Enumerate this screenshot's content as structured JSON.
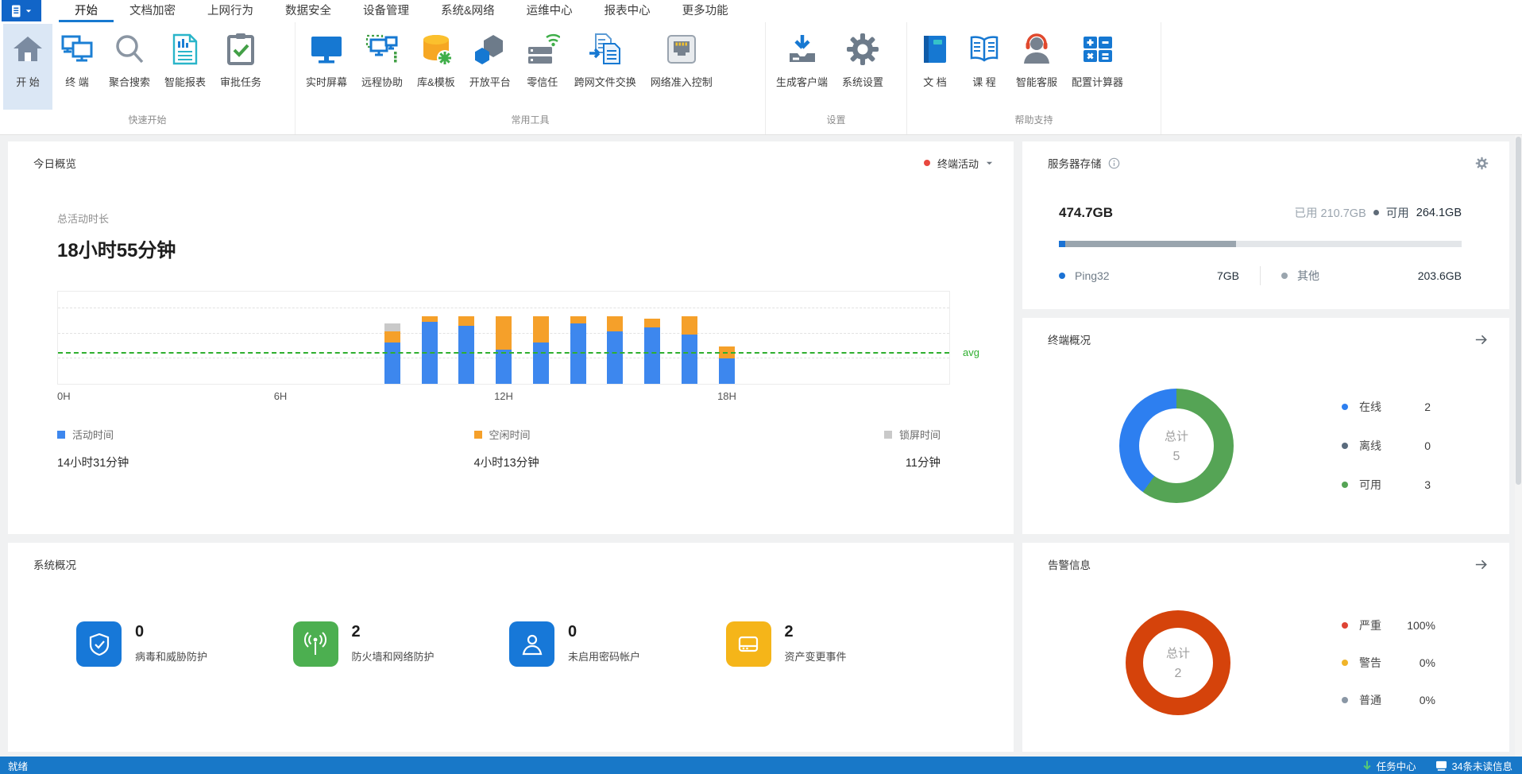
{
  "menu": {
    "tabs": [
      "开始",
      "文档加密",
      "上网行为",
      "数据安全",
      "设备管理",
      "系统&网络",
      "运维中心",
      "报表中心",
      "更多功能"
    ],
    "active": "开始"
  },
  "ribbon": {
    "groups": [
      {
        "label": "快速开始",
        "items": [
          {
            "label": "开 始",
            "icon": "home-icon",
            "selected": true
          },
          {
            "label": "终 端",
            "icon": "terminal-icon"
          },
          {
            "label": "聚合搜索",
            "icon": "search-icon"
          },
          {
            "label": "智能报表",
            "icon": "report-icon"
          },
          {
            "label": "审批任务",
            "icon": "approval-task-icon"
          }
        ]
      },
      {
        "label": "常用工具",
        "items": [
          {
            "label": "实时屏幕",
            "icon": "realtime-screen-icon"
          },
          {
            "label": "远程协助",
            "icon": "remote-assist-icon"
          },
          {
            "label": "库&模板",
            "icon": "library-template-icon"
          },
          {
            "label": "开放平台",
            "icon": "open-platform-icon"
          },
          {
            "label": "零信任",
            "icon": "zero-trust-icon"
          },
          {
            "label": "跨网文件交换",
            "icon": "file-exchange-icon"
          },
          {
            "label": "网络准入控制",
            "icon": "network-access-icon"
          }
        ]
      },
      {
        "label": "设置",
        "items": [
          {
            "label": "生成客户端",
            "icon": "generate-client-icon"
          },
          {
            "label": "系统设置",
            "icon": "gear-icon"
          }
        ]
      },
      {
        "label": "帮助支持",
        "items": [
          {
            "label": "文 档",
            "icon": "document-book-icon"
          },
          {
            "label": "课 程",
            "icon": "course-book-icon"
          },
          {
            "label": "智能客服",
            "icon": "customer-service-icon"
          },
          {
            "label": "配置计算器",
            "icon": "calculator-icon"
          }
        ]
      }
    ]
  },
  "overview": {
    "title": "今日概览",
    "selector": {
      "label": "终端活动",
      "dot_color": "#e8483f"
    },
    "total_label": "总活动时长",
    "total_value": "18小时55分钟",
    "chart_data": {
      "type": "bar",
      "stacked": true,
      "x_hours": [
        9,
        10,
        11,
        12,
        13,
        14,
        15,
        16,
        17,
        18
      ],
      "series": [
        {
          "name": "活动时间",
          "color": "#3d87ee",
          "values_min": [
            33,
            49,
            46,
            27,
            33,
            48,
            42,
            45,
            39,
            20
          ]
        },
        {
          "name": "空闲时间",
          "color": "#f5a02a",
          "values_min": [
            9,
            5,
            8,
            27,
            21,
            6,
            12,
            7,
            15,
            10
          ]
        },
        {
          "name": "锁屏时间",
          "color": "#c9c9c9",
          "values_min": [
            6,
            0,
            0,
            0,
            0,
            0,
            0,
            0,
            0,
            0
          ]
        }
      ],
      "x_axis": {
        "range_hours": [
          0,
          24
        ],
        "ticks": [
          {
            "label": "0H",
            "hour": 0
          },
          {
            "label": "6H",
            "hour": 6
          },
          {
            "label": "12H",
            "hour": 12
          },
          {
            "label": "18H",
            "hour": 18
          }
        ]
      },
      "y_axis": {
        "unit": "minutes",
        "gridlines_min": [
          20,
          40,
          60
        ],
        "max_min": 74
      },
      "avg_line": {
        "label": "avg",
        "value_min": 24,
        "color": "#2faf2f"
      },
      "grid": true,
      "legend_position": "bottom"
    },
    "legend": [
      {
        "label": "活动时间",
        "value": "14小时31分钟",
        "color": "#3d87ee"
      },
      {
        "label": "空闲时间",
        "value": "4小时13分钟",
        "color": "#f5a02a"
      },
      {
        "label": "锁屏时间",
        "value": "11分钟",
        "color": "#c9c9c9"
      }
    ]
  },
  "storage": {
    "title": "服务器存储",
    "total": "474.7GB",
    "used_label": "已用",
    "used_value": "210.7GB",
    "free_label": "可用",
    "free_value": "264.1GB",
    "bar_segments": [
      {
        "name": "Ping32",
        "pct": 1.5,
        "color": "#1b72d4"
      },
      {
        "name": "其他",
        "pct": 42.4,
        "color": "#9aa5ae"
      },
      {
        "name": "free",
        "pct": 56.1,
        "color": "#e3e6e9"
      }
    ],
    "items": [
      {
        "label": "Ping32",
        "value": "7GB",
        "color": "#1b72d4"
      },
      {
        "label": "其他",
        "value": "203.6GB",
        "color": "#9aa5ae"
      }
    ]
  },
  "terminals": {
    "title": "终端概况",
    "center_label": "总计",
    "center_value": "5",
    "chart_data": {
      "type": "pie",
      "donut": true,
      "total": 5,
      "slices": [
        {
          "label": "可用",
          "value": 3,
          "color": "#55a455"
        },
        {
          "label": "在线",
          "value": 2,
          "color": "#2d7ff0"
        },
        {
          "label": "离线",
          "value": 0,
          "color": "#5a6b7d"
        }
      ]
    },
    "legend": [
      {
        "label": "在线",
        "value": "2",
        "color": "#2d7ff0"
      },
      {
        "label": "离线",
        "value": "0",
        "color": "#5a6b7d"
      },
      {
        "label": "可用",
        "value": "3",
        "color": "#55a455"
      }
    ]
  },
  "system": {
    "title": "系统概况",
    "items": [
      {
        "value": "0",
        "label": "病毒和威胁防护",
        "icon": "shield-check-icon",
        "color": "#1778d8"
      },
      {
        "value": "2",
        "label": "防火墙和网络防护",
        "icon": "broadcast-icon",
        "color": "#4caf50"
      },
      {
        "value": "0",
        "label": "未启用密码帐户",
        "icon": "user-account-icon",
        "color": "#1778d8"
      },
      {
        "value": "2",
        "label": "资产变更事件",
        "icon": "asset-device-icon",
        "color": "#f5b519"
      }
    ]
  },
  "alerts": {
    "title": "告警信息",
    "center_label": "总计",
    "center_value": "2",
    "chart_data": {
      "type": "pie",
      "donut": true,
      "total": 2,
      "slices": [
        {
          "label": "严重",
          "value": 2,
          "color": "#d5430b"
        },
        {
          "label": "警告",
          "value": 0,
          "color": "#f0b429"
        },
        {
          "label": "普通",
          "value": 0,
          "color": "#8a97a5"
        }
      ]
    },
    "legend": [
      {
        "label": "严重",
        "value": "100%",
        "color": "#de4434"
      },
      {
        "label": "警告",
        "value": "0%",
        "color": "#f0b429"
      },
      {
        "label": "普通",
        "value": "0%",
        "color": "#8a97a5"
      }
    ]
  },
  "statusbar": {
    "ready": "就绪",
    "task_center": "任务中心",
    "unread": "34条未读信息"
  }
}
